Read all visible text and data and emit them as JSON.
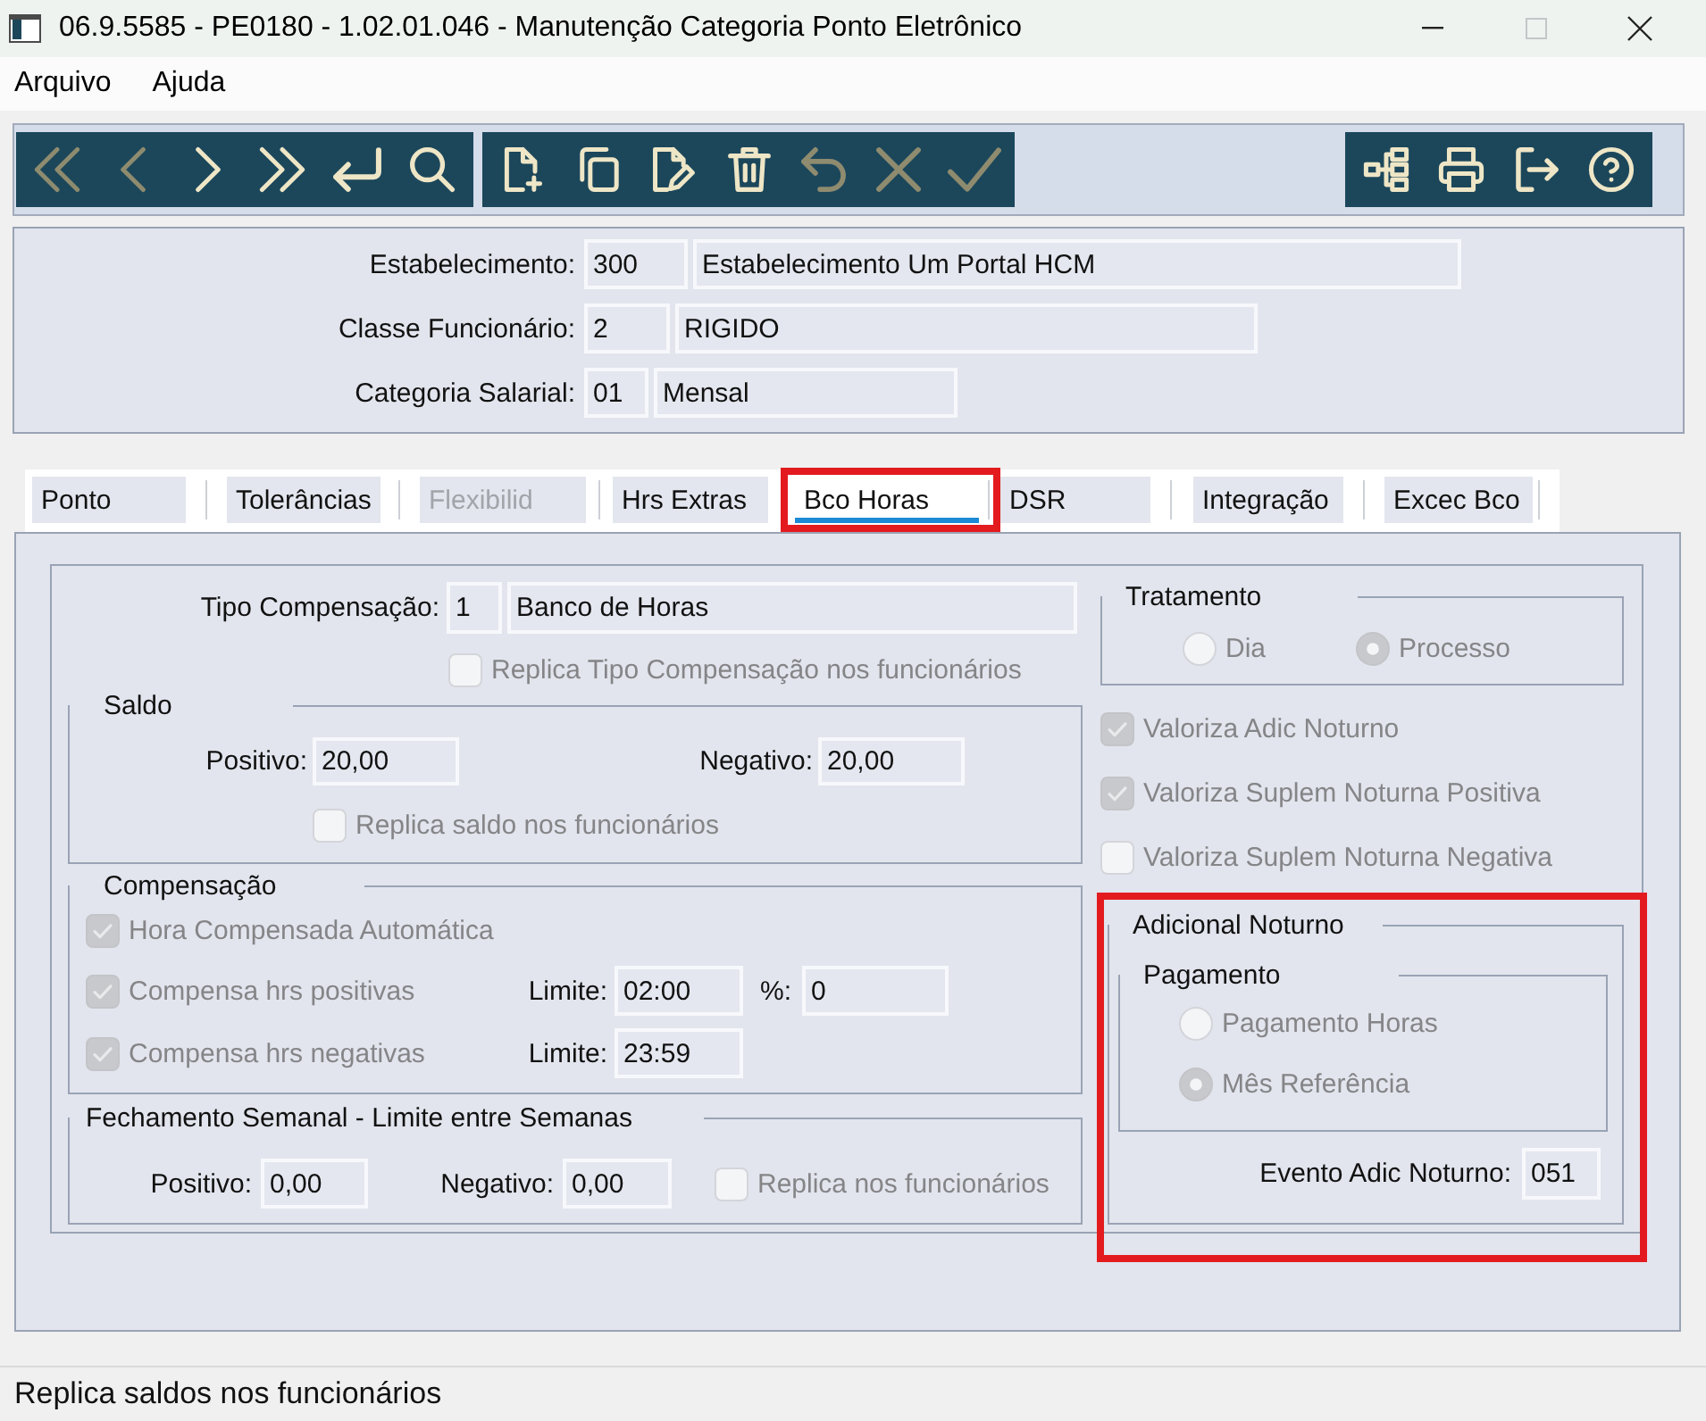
{
  "window": {
    "title": "06.9.5585 - PE0180 - 1.02.01.046 - Manutenção Categoria Ponto Eletrônico",
    "maximize_disabled": true
  },
  "menu": [
    {
      "label": "Arquivo"
    },
    {
      "label": "Ajuda"
    }
  ],
  "toolbar": {
    "groups": [
      [
        {
          "disabled": true
        },
        {
          "disabled": true
        },
        {
          "disabled": false
        },
        {
          "disabled": false
        },
        {
          "disabled": false
        },
        {
          "disabled": false
        }
      ],
      [
        {
          "disabled": false
        },
        {
          "disabled": false
        },
        {
          "disabled": false
        },
        {
          "disabled": false
        },
        {
          "disabled": true
        },
        {
          "disabled": true
        },
        {
          "disabled": true
        }
      ],
      [
        {
          "disabled": false
        },
        {
          "disabled": false
        },
        {
          "disabled": false
        },
        {
          "disabled": false
        }
      ]
    ]
  },
  "header": [
    {
      "label": "Estabelecimento:",
      "code": "300",
      "description": "Estabelecimento Um Portal HCM"
    },
    {
      "label": "Classe Funcionário:",
      "code": "2",
      "description": "RIGIDO"
    },
    {
      "label": "Categoria Salarial:",
      "code": "01",
      "description": "Mensal"
    }
  ],
  "tabs": [
    {
      "label": "Ponto",
      "selected": false,
      "disabled": false,
      "highlighted": false
    },
    {
      "label": "Tolerâncias",
      "selected": false,
      "disabled": false,
      "highlighted": false
    },
    {
      "label": "Flexibilid",
      "selected": false,
      "disabled": true,
      "highlighted": false
    },
    {
      "label": "Hrs Extras",
      "selected": false,
      "disabled": false,
      "highlighted": false
    },
    {
      "label": "Bco Horas",
      "selected": true,
      "disabled": false,
      "highlighted": true
    },
    {
      "label": "DSR",
      "selected": false,
      "disabled": false,
      "highlighted": false
    },
    {
      "label": "Integração",
      "selected": false,
      "disabled": false,
      "highlighted": false
    },
    {
      "label": "Excec Bco",
      "selected": false,
      "disabled": false,
      "highlighted": false
    }
  ],
  "bco_horas": {
    "tipo_compensacao": {
      "label": "Tipo Compensação:",
      "code": "1",
      "description": "Banco de Horas"
    },
    "replica_tipo": {
      "label": "Replica Tipo Compensação nos funcionários",
      "checked": false,
      "disabled": true
    },
    "saldo": {
      "title": "Saldo",
      "positivo": {
        "label": "Positivo:",
        "value": "20,00"
      },
      "negativo": {
        "label": "Negativo:",
        "value": "20,00"
      },
      "replica": {
        "label": "Replica saldo nos funcionários",
        "checked": false,
        "disabled": true
      }
    },
    "compensacao": {
      "title": "Compensação",
      "hora_automatica": {
        "label": "Hora Compensada Automática",
        "checked": true,
        "disabled": true
      },
      "positivas": {
        "label": "Compensa hrs positivas",
        "checked": true,
        "disabled": true
      },
      "limite_positivas": {
        "label": "Limite:",
        "value": "02:00"
      },
      "percentual": {
        "label": "%:",
        "value": "0"
      },
      "negativas": {
        "label": "Compensa hrs negativas",
        "checked": true,
        "disabled": true
      },
      "limite_negativas": {
        "label": "Limite:",
        "value": "23:59"
      }
    },
    "fechamento_semanal": {
      "title": "Fechamento Semanal - Limite entre Semanas",
      "positivo": {
        "label": "Positivo:",
        "value": "0,00"
      },
      "negativo": {
        "label": "Negativo:",
        "value": "0,00"
      },
      "replica": {
        "label": "Replica nos funcionários",
        "checked": false,
        "disabled": true
      }
    },
    "tratamento": {
      "title": "Tratamento",
      "options": [
        {
          "label": "Dia",
          "selected": false,
          "disabled": true
        },
        {
          "label": "Processo",
          "selected": true,
          "disabled": true
        }
      ]
    },
    "valoriza": [
      {
        "label": "Valoriza Adic Noturno",
        "checked": true,
        "disabled": true
      },
      {
        "label": "Valoriza Suplem Noturna Positiva",
        "checked": true,
        "disabled": true
      },
      {
        "label": "Valoriza Suplem Noturna Negativa",
        "checked": false,
        "disabled": true
      }
    ],
    "adicional_noturno": {
      "title": "Adicional Noturno",
      "highlighted": true,
      "pagamento": {
        "title": "Pagamento",
        "options": [
          {
            "label": "Pagamento Horas",
            "selected": false,
            "disabled": true
          },
          {
            "label": "Mês Referência",
            "selected": true,
            "disabled": true
          }
        ]
      },
      "evento": {
        "label": "Evento Adic Noturno:",
        "value": "051"
      }
    }
  },
  "status_bar": {
    "text": "Replica saldos nos funcionários"
  }
}
